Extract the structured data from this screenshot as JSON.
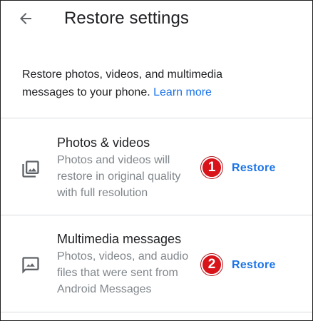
{
  "header": {
    "title": "Restore settings",
    "back_icon": "arrow-back-icon"
  },
  "intro": {
    "text": "Restore photos, videos, and multimedia messages to your phone.",
    "link": "Learn more"
  },
  "sections": [
    {
      "icon": "photo-library-icon",
      "title": "Photos & videos",
      "subtitle": "Photos and videos will restore in original quality with full resolution",
      "badge": "1",
      "action": "Restore"
    },
    {
      "icon": "image-message-icon",
      "title": "Multimedia messages",
      "subtitle": "Photos, videos, and audio files that were sent from Android Messages",
      "badge": "2",
      "action": "Restore"
    }
  ],
  "colors": {
    "link": "#1a73e8",
    "badge": "#d8141a",
    "divider": "#dadce0",
    "secondary_text": "#80868b"
  }
}
